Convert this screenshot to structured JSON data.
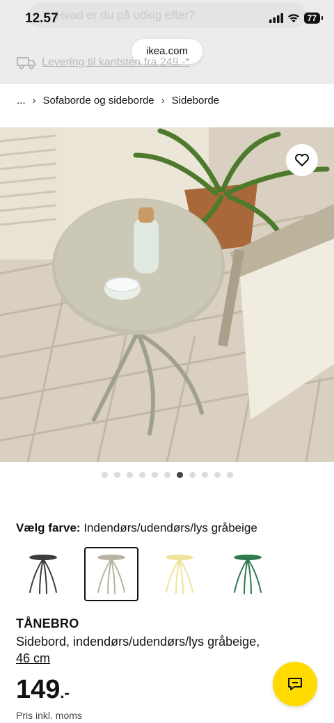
{
  "status_bar": {
    "time": "12.57",
    "battery": "77"
  },
  "browser": {
    "search_placeholder": "Hvad er du på udkig efter?",
    "url": "ikea.com"
  },
  "delivery_banner": {
    "text": "Levering til kantsten fra 249.-*"
  },
  "breadcrumb": {
    "items": [
      "...",
      "Sofaborde og sideborde",
      "Sideborde"
    ]
  },
  "gallery": {
    "total_images": 11,
    "active_index": 6
  },
  "color_choice": {
    "label": "Vælg farve:",
    "selected_value": "Indendørs/udendørs/lys gråbeige",
    "swatches": [
      {
        "name": "dark-grey",
        "color": "#3b3b3b"
      },
      {
        "name": "light-grey-beige",
        "color": "#b8b3a2"
      },
      {
        "name": "yellow",
        "color": "#efe39a"
      },
      {
        "name": "green",
        "color": "#2e7a4e"
      }
    ],
    "selected_index": 1
  },
  "product": {
    "name": "TÅNEBRO",
    "description": "Sidebord, indendørs/udendørs/lys gråbeige,",
    "size": "46 cm",
    "price": "149",
    "price_suffix": ".-",
    "price_note": "Pris inkl. moms"
  },
  "colors": {
    "accent_yellow": "#ffdb00"
  }
}
